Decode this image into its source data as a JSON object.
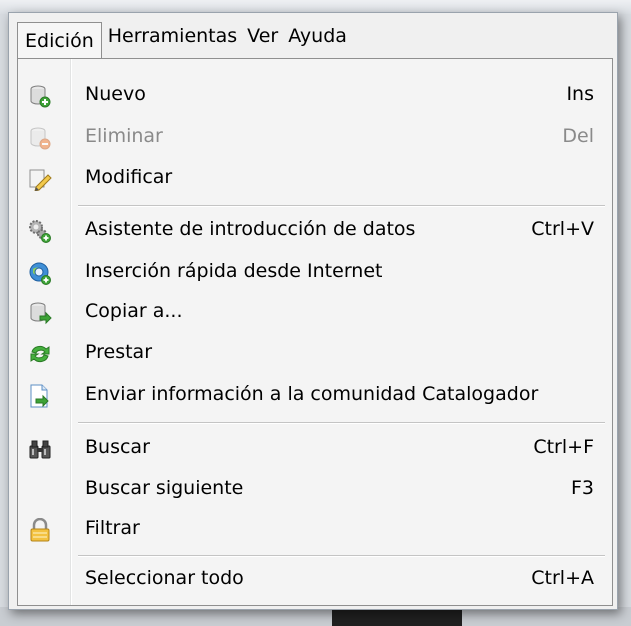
{
  "menubar": {
    "items": [
      "Edición",
      "Herramientas",
      "Ver",
      "Ayuda"
    ]
  },
  "menu": {
    "items": [
      {
        "label": "Nuevo",
        "shortcut": "Ins",
        "icon": "database-add-icon",
        "enabled": true
      },
      {
        "label": "Eliminar",
        "shortcut": "Del",
        "icon": "database-remove-icon",
        "enabled": false
      },
      {
        "label": "Modificar",
        "shortcut": "",
        "icon": "pencil-icon",
        "enabled": true
      },
      {
        "label": "Asistente de introducción de datos",
        "shortcut": "Ctrl+V",
        "icon": "gears-add-icon",
        "enabled": true
      },
      {
        "label": "Inserción rápida desde Internet",
        "shortcut": "",
        "icon": "globe-add-icon",
        "enabled": true
      },
      {
        "label": "Copiar a...",
        "shortcut": "",
        "icon": "database-copy-icon",
        "enabled": true
      },
      {
        "label": "Prestar",
        "shortcut": "",
        "icon": "green-arrows-icon",
        "enabled": true
      },
      {
        "label": "Enviar información a la comunidad Catalogador",
        "shortcut": "",
        "icon": "document-send-icon",
        "enabled": true
      },
      {
        "label": "Buscar",
        "shortcut": "Ctrl+F",
        "icon": "binoculars-icon",
        "enabled": true
      },
      {
        "label": "Buscar siguiente",
        "shortcut": "F3",
        "icon": "",
        "enabled": true
      },
      {
        "label": "Filtrar",
        "shortcut": "",
        "icon": "padlock-icon",
        "enabled": true
      },
      {
        "label": "Seleccionar todo",
        "shortcut": "Ctrl+A",
        "icon": "",
        "enabled": true
      }
    ]
  }
}
